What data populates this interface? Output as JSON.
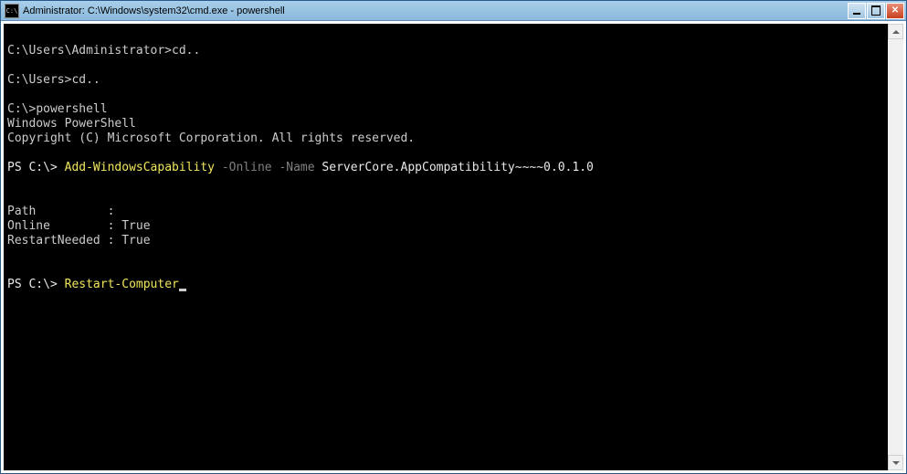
{
  "window": {
    "title": "Administrator: C:\\Windows\\system32\\cmd.exe - powershell",
    "icon_text": "C:\\"
  },
  "terminal": {
    "line1_prompt": "C:\\Users\\Administrator>",
    "line1_cmd": "cd..",
    "line2_prompt": "C:\\Users>",
    "line2_cmd": "cd..",
    "line3_prompt": "C:\\>",
    "line3_cmd": "powershell",
    "banner1": "Windows PowerShell",
    "banner2": "Copyright (C) Microsoft Corporation. All rights reserved.",
    "ps1_prompt": "PS C:\\> ",
    "ps1_cmdlet": "Add-WindowsCapability",
    "ps1_param1_name": " -Online",
    "ps1_param2_name": " -Name",
    "ps1_param2_value": " ServerCore.AppCompatibility~~~~0.0.1.0",
    "out_path_label": "Path          :",
    "out_online_label": "Online        : ",
    "out_online_value": "True",
    "out_restart_label": "RestartNeeded : ",
    "out_restart_value": "True",
    "ps2_prompt": "PS C:\\> ",
    "ps2_cmdlet": "Restart-Computer"
  }
}
